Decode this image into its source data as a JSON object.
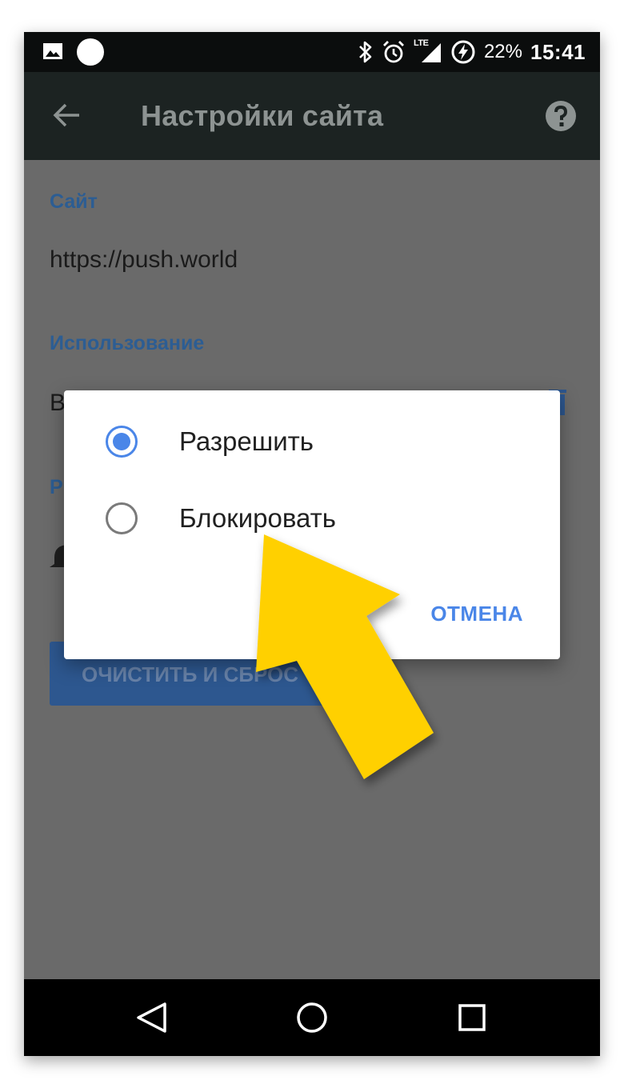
{
  "status_bar": {
    "battery_percent": "22%",
    "time": "15:41",
    "network_label": "LTE",
    "icons": [
      "gallery-icon",
      "circle-notification-icon",
      "bluetooth-icon",
      "alarm-icon",
      "lte-signal-icon",
      "battery-charging-icon"
    ]
  },
  "toolbar": {
    "title": "Настройки сайта",
    "back_icon": "arrow-left-icon",
    "help_icon": "help-circle-icon"
  },
  "content": {
    "site_section_label": "Сайт",
    "site_url": "https://push.world",
    "usage_section_label": "Использование",
    "usage_peek_text": "В",
    "permissions_peek_text": "Р",
    "clear_button_label": "ОЧИСТИТЬ И СБРОС"
  },
  "dialog": {
    "options": [
      {
        "label": "Разрешить",
        "selected": true
      },
      {
        "label": "Блокировать",
        "selected": false
      }
    ],
    "cancel_label": "ОТМЕНА"
  },
  "colors": {
    "accent": "#4a86e8",
    "arrow": "#ffd000",
    "scrim_background": "#6a6a6a",
    "toolbar": "#1c2322"
  },
  "nav_bar": {
    "icons": [
      "nav-back-icon",
      "nav-home-icon",
      "nav-recents-icon"
    ]
  }
}
